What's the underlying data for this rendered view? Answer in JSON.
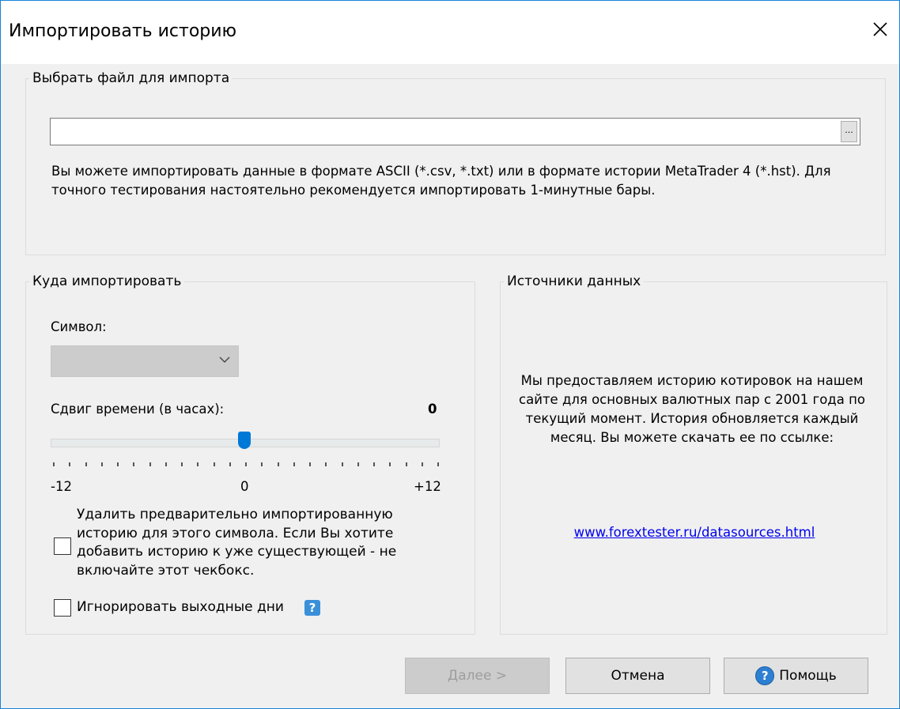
{
  "window": {
    "title": "Импортировать историю",
    "close_glyph": "✕",
    "accent_color": "#1883d7"
  },
  "file_group": {
    "legend": "Выбрать файл для импорта",
    "path_value": "",
    "browse_label": "...",
    "description": "Вы можете импортировать данные в формате ASCII (*.csv, *.txt) или в формате истории MetaTrader 4 (*.hst). Для точного тестирования настоятельно рекомендуется импортировать 1-минутные бары."
  },
  "target_group": {
    "legend": "Куда импортировать",
    "symbol_label": "Символ:",
    "symbol_value": "",
    "shift_label": "Сдвиг времени (в часах):",
    "shift_value": "0",
    "shift_min_label": "-12",
    "shift_mid_label": "0",
    "shift_max_label": "+12",
    "shift_level": 0,
    "delete_checkbox_label": "Удалить предварительно импортированную историю для этого символа. Если Вы хотите добавить историю к уже существующей - не включайте этот чекбокс.",
    "delete_checked": false,
    "ignore_weekends_label": "Игнорировать выходные дни",
    "ignore_weekends_checked": false,
    "help_icon_glyph": "?"
  },
  "sources_group": {
    "legend": "Источники данных",
    "text": "Мы предоставляем историю котировок на нашем сайте для основных валютных пар с 2001 года по текущий момент. История обновляется каждый месяц. Вы можете скачать ее по ссылке:",
    "link": "www.forextester.ru/datasources.html"
  },
  "buttons": {
    "next": "Далее >",
    "cancel": "Отмена",
    "help": "Помощь",
    "help_glyph": "?"
  }
}
